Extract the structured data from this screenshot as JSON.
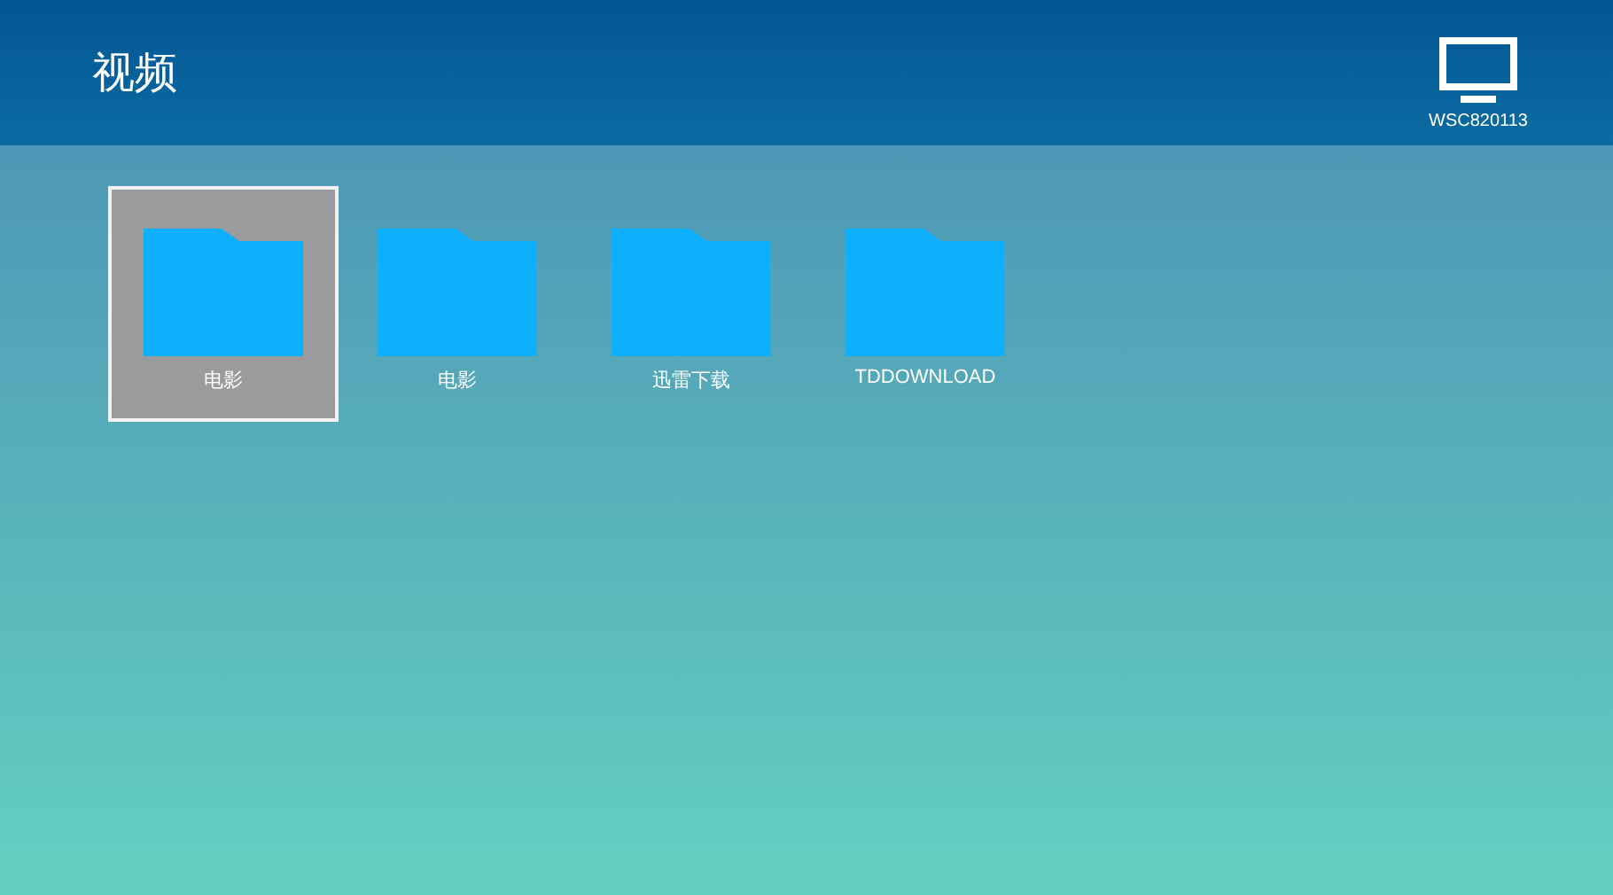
{
  "header": {
    "title": "视频",
    "device": {
      "label": "WSC820113"
    }
  },
  "folders": [
    {
      "label": "电影",
      "selected": true
    },
    {
      "label": "电影",
      "selected": false
    },
    {
      "label": "迅雷下载",
      "selected": false
    },
    {
      "label": "TDDOWNLOAD",
      "selected": false
    }
  ]
}
